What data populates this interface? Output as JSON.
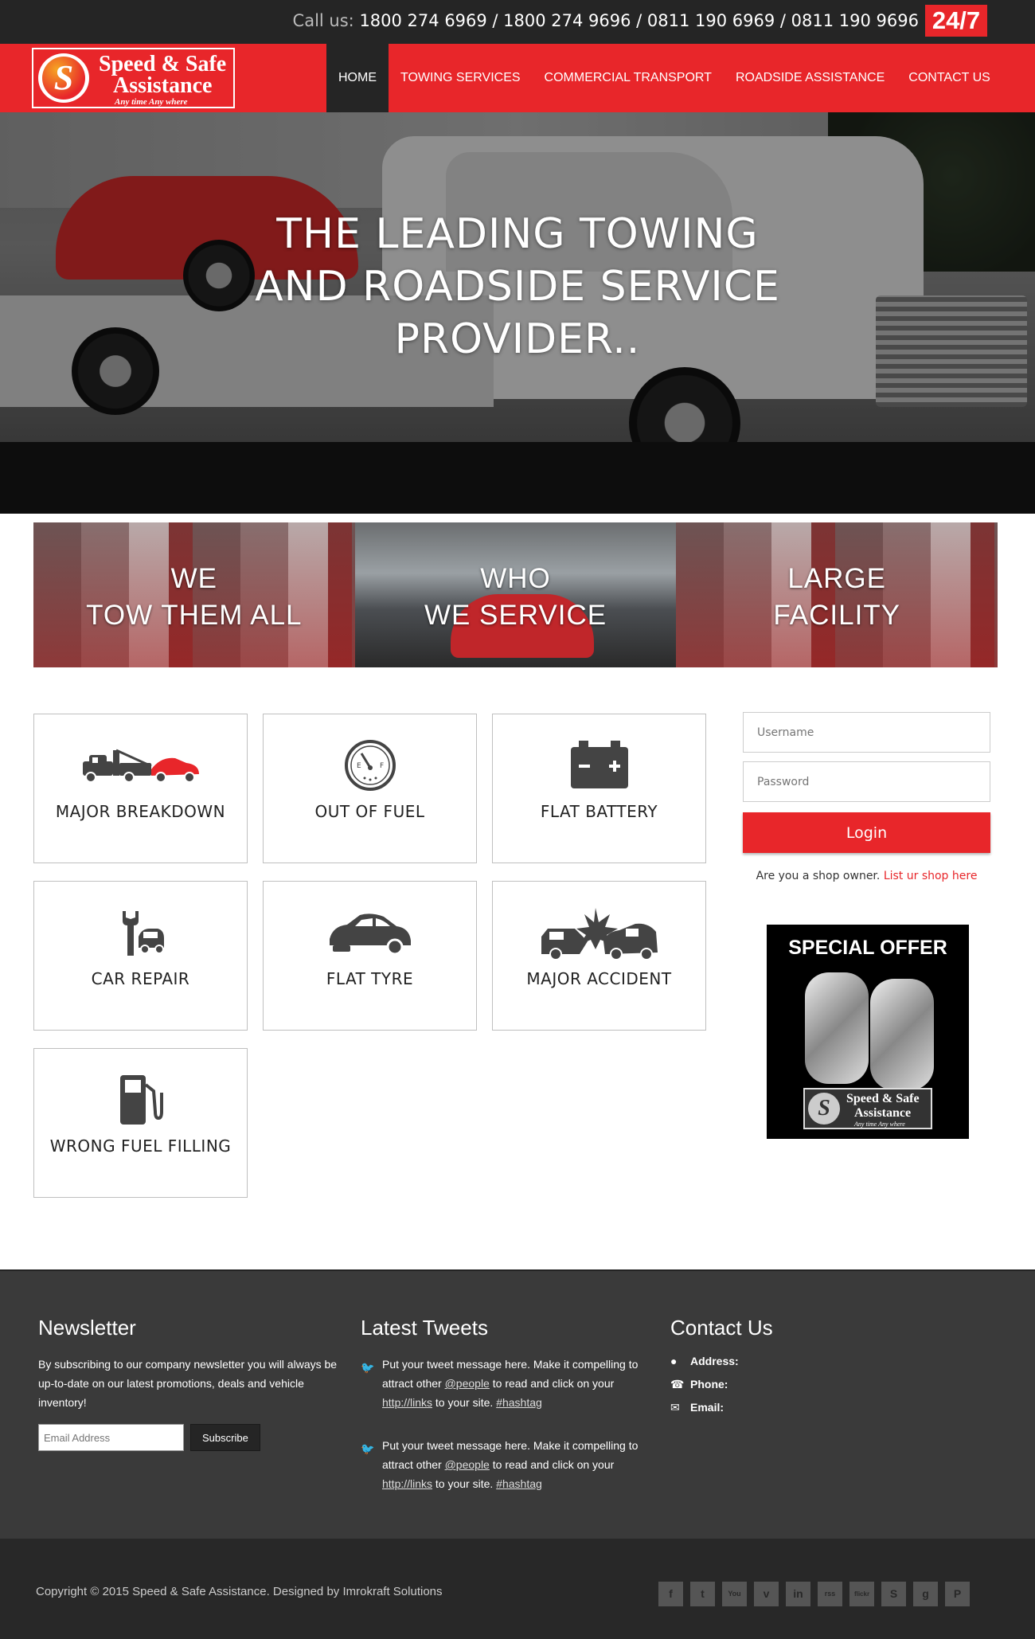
{
  "topbar": {
    "call_label": "Call us:",
    "phones": "1800 274 6969 / 1800 274 9696 / 0811 190 6969 / 0811 190 9696",
    "badge": "24/7"
  },
  "logo": {
    "letter": "S",
    "line1": "Speed & Safe",
    "line2": "Assistance",
    "tagline": "Any time Any where"
  },
  "nav": {
    "items": [
      {
        "label": "HOME",
        "active": true
      },
      {
        "label": "TOWING SERVICES"
      },
      {
        "label": "COMMERCIAL TRANSPORT"
      },
      {
        "label": "ROADSIDE ASSISTANCE"
      },
      {
        "label": "CONTACT US"
      }
    ]
  },
  "hero": {
    "line1": "THE LEADING TOWING",
    "line2": "AND ROADSIDE SERVICE",
    "line3": "PROVIDER.."
  },
  "features": [
    {
      "line1": "WE",
      "line2": "TOW THEM ALL"
    },
    {
      "line1": "WHO",
      "line2": "WE SERVICE"
    },
    {
      "line1": "LARGE",
      "line2": "FACILITY"
    }
  ],
  "services": [
    {
      "label": "MAJOR BREAKDOWN",
      "icon": "tow-truck-icon"
    },
    {
      "label": "OUT OF FUEL",
      "icon": "fuel-gauge-icon"
    },
    {
      "label": "FLAT BATTERY",
      "icon": "battery-icon"
    },
    {
      "label": "CAR REPAIR",
      "icon": "wrench-car-icon"
    },
    {
      "label": "FLAT TYRE",
      "icon": "flat-tyre-icon"
    },
    {
      "label": "MAJOR ACCIDENT",
      "icon": "car-crash-icon"
    },
    {
      "label": "WRONG FUEL FILLING",
      "icon": "fuel-pump-icon"
    }
  ],
  "login": {
    "username_placeholder": "Username",
    "password_placeholder": "Password",
    "button": "Login",
    "shop_prompt": "Are you a shop owner.",
    "shop_link": "List ur shop here"
  },
  "offer": {
    "title": "SPECIAL OFFER",
    "logo_line1": "Speed & Safe",
    "logo_line2": "Assistance",
    "logo_tagline": "Any time Any where"
  },
  "footer": {
    "newsletter": {
      "title": "Newsletter",
      "text": "By subscribing to our company newsletter you will always be up-to-date on our latest promotions, deals and vehicle inventory!",
      "placeholder": "Email Address",
      "button": "Subscribe"
    },
    "tweets": {
      "title": "Latest Tweets",
      "items": [
        {
          "pre": "Put your tweet message here. Make it compelling to attract other ",
          "mention": "@people",
          "mid": " to read and click on your ",
          "link": "http://links",
          "post": " to your site. ",
          "hashtag": "#hashtag"
        },
        {
          "pre": "Put your tweet message here. Make it compelling to attract other ",
          "mention": "@people",
          "mid": " to read and click on your ",
          "link": "http://links",
          "post": " to your site. ",
          "hashtag": "#hashtag"
        }
      ]
    },
    "contact": {
      "title": "Contact Us",
      "address": "Address:",
      "phone": "Phone:",
      "email": "Email:"
    }
  },
  "bottom": {
    "copyright": "Copyright © 2015 Speed & Safe Assistance. Designed by Imrokraft Solutions",
    "social": [
      "f",
      "t",
      "You",
      "v",
      "in",
      "rss",
      "flickr",
      "S",
      "g",
      "P"
    ]
  },
  "colors": {
    "brand_red": "#e8262a",
    "dark": "#252525",
    "footer": "#3a3a3a"
  }
}
